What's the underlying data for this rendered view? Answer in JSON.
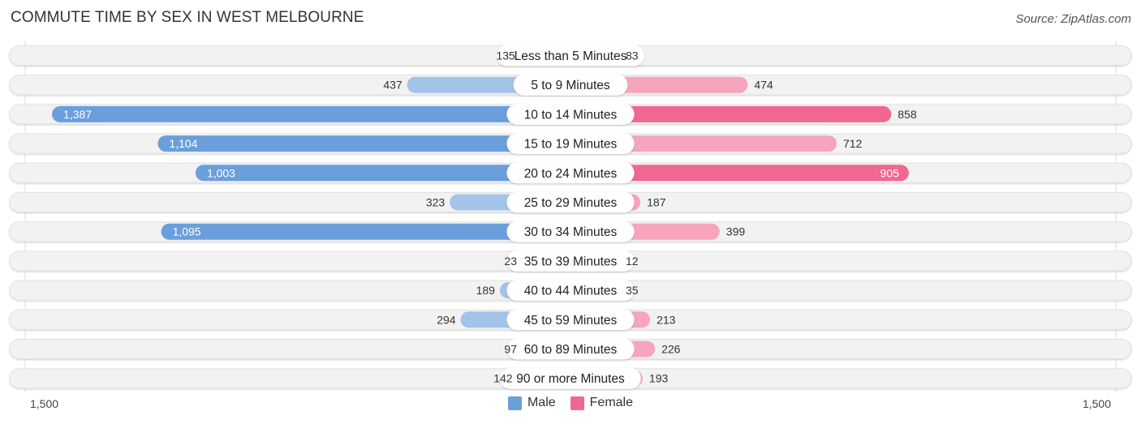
{
  "title": "COMMUTE TIME BY SEX IN WEST MELBOURNE",
  "source": "Source: ZipAtlas.com",
  "colors": {
    "male_strong": "#6a9fdc",
    "male_light": "#a3c4e9",
    "female_strong": "#f06890",
    "female_light": "#f6a5bd",
    "track": "#f2f2f2"
  },
  "legend": [
    {
      "label": "Male",
      "color": "#6a9fdc"
    },
    {
      "label": "Female",
      "color": "#f06890"
    }
  ],
  "chart_data": {
    "type": "bar",
    "orientation": "horizontal-diverging",
    "title": "COMMUTE TIME BY SEX IN WEST MELBOURNE",
    "categories": [
      "Less than 5 Minutes",
      "5 to 9 Minutes",
      "10 to 14 Minutes",
      "15 to 19 Minutes",
      "20 to 24 Minutes",
      "25 to 29 Minutes",
      "30 to 34 Minutes",
      "35 to 39 Minutes",
      "40 to 44 Minutes",
      "45 to 59 Minutes",
      "60 to 89 Minutes",
      "90 or more Minutes"
    ],
    "series": [
      {
        "name": "Male",
        "values": [
          135,
          437,
          1387,
          1104,
          1003,
          323,
          1095,
          23,
          189,
          294,
          97,
          142
        ]
      },
      {
        "name": "Female",
        "values": [
          83,
          474,
          858,
          712,
          905,
          187,
          399,
          12,
          35,
          213,
          226,
          193
        ]
      }
    ],
    "value_labels": {
      "male": [
        "135",
        "437",
        "1,387",
        "1,104",
        "1,003",
        "323",
        "1,095",
        "23",
        "189",
        "294",
        "97",
        "142"
      ],
      "female": [
        "83",
        "474",
        "858",
        "712",
        "905",
        "187",
        "399",
        "12",
        "35",
        "213",
        "226",
        "193"
      ]
    },
    "xlim": [
      -1500,
      1500
    ],
    "axis_labels": {
      "left": "1,500",
      "right": "1,500"
    },
    "legend_position": "bottom-center",
    "grid": false
  }
}
